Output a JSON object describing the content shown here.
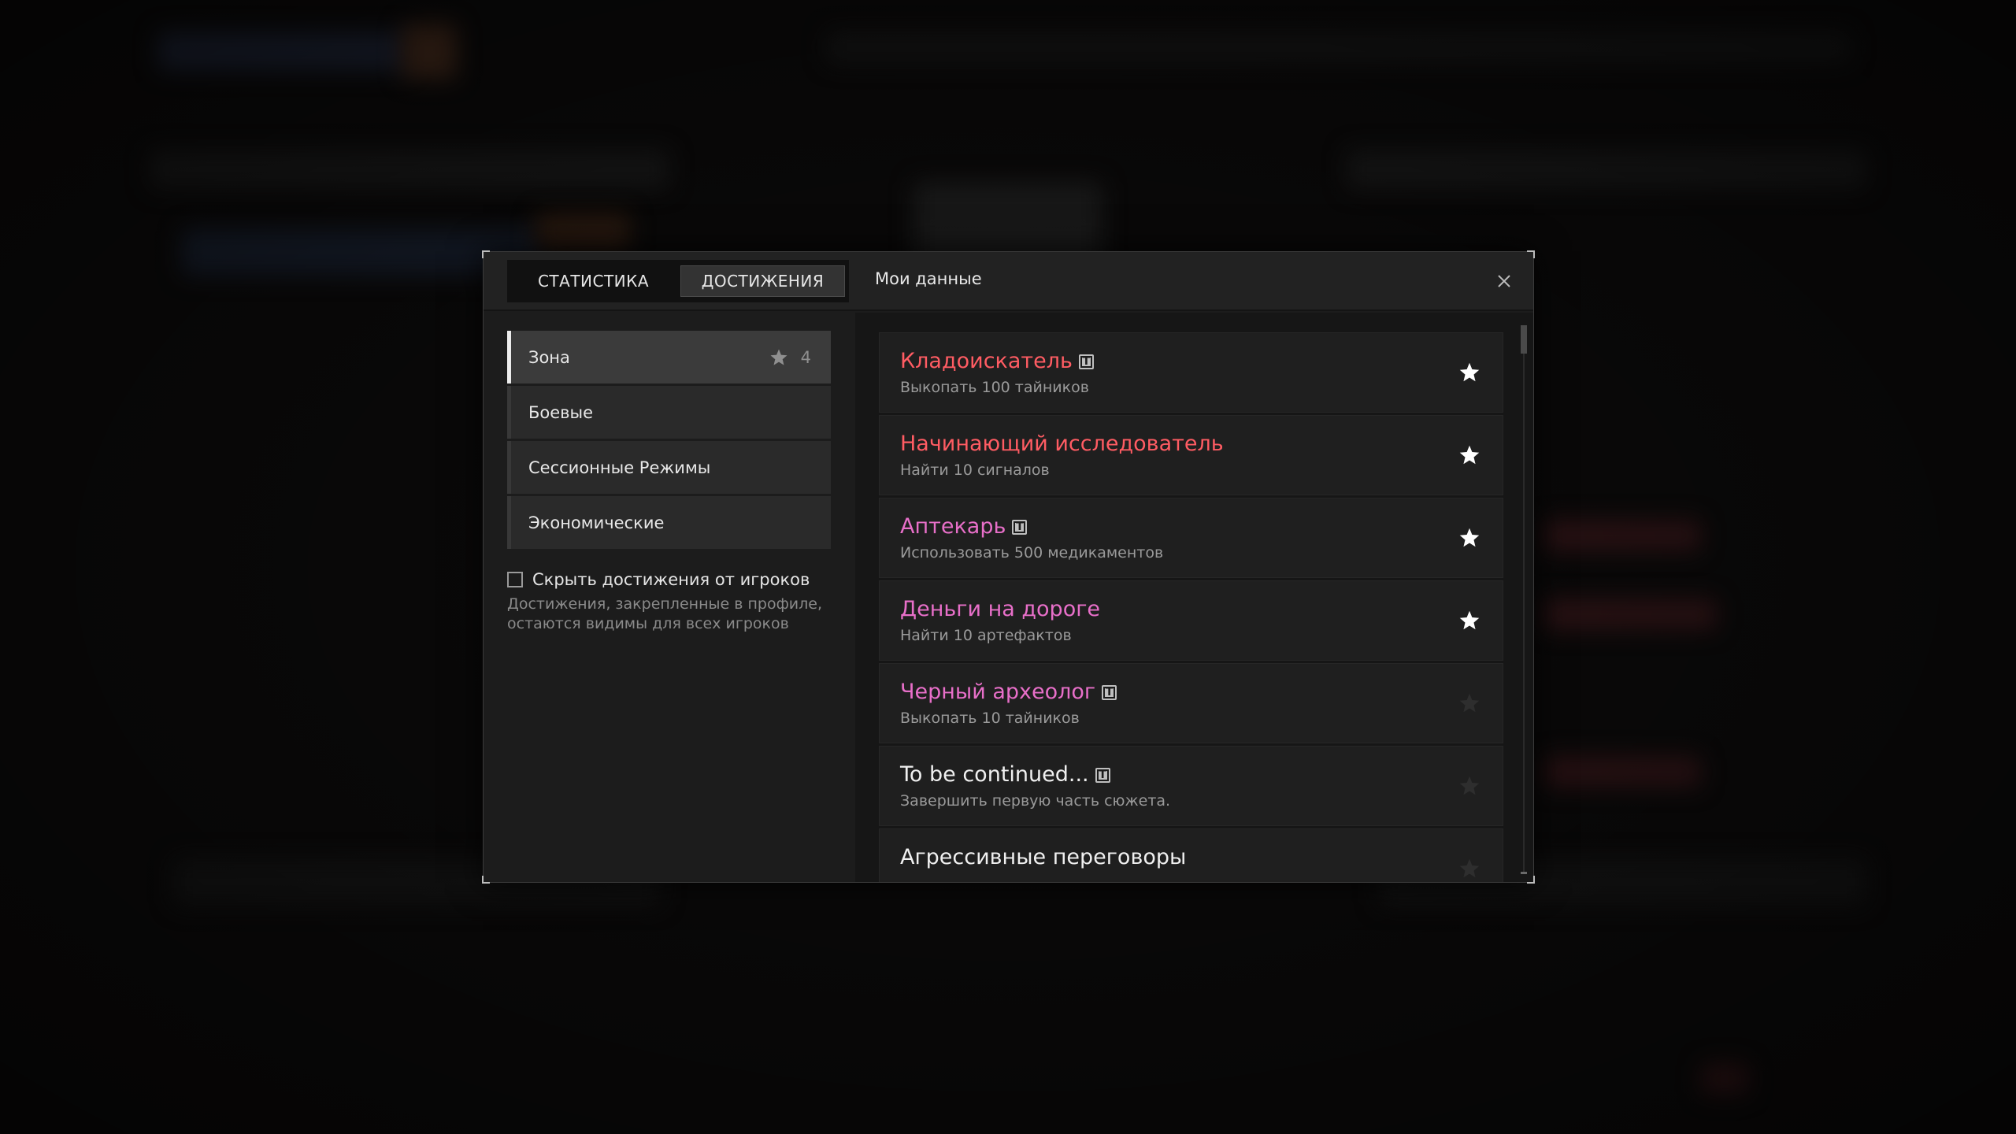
{
  "header": {
    "tabs": [
      {
        "label": "СТАТИСТИКА"
      },
      {
        "label": "ДОСТИЖЕНИЯ"
      }
    ],
    "title": "Мои данные"
  },
  "categories": [
    {
      "label": "Зона",
      "count": "4"
    },
    {
      "label": "Боевые"
    },
    {
      "label": "Сессионные Режимы"
    },
    {
      "label": "Экономические"
    }
  ],
  "hide_option": {
    "label": "Скрыть достижения от игроков",
    "note": "Достижения, закрепленные в профиле, остаются видимы для всех игроков"
  },
  "achievements": [
    {
      "title": "Кладоискатель",
      "desc": "Выкопать 100 тайников",
      "color": "#ff5c63",
      "starred": true
    },
    {
      "title": "Начинающий исследователь",
      "desc": "Найти 10 сигналов",
      "color": "#ff5c63",
      "starred": true
    },
    {
      "title": "Аптекарь",
      "desc": "Использовать 500 медикаментов",
      "color": "#e86fc9",
      "starred": true
    },
    {
      "title": "Деньги на дороге",
      "desc": "Найти 10 артефактов",
      "color": "#e86fc9",
      "starred": true
    },
    {
      "title": "Черный археолог",
      "desc": "Выкопать 10 тайников",
      "color": "#e86fc9",
      "starred": false
    },
    {
      "title": "To be continued...",
      "desc": "Завершить первую часть сюжета.",
      "color": "#f0f0f0",
      "starred": false
    },
    {
      "title": "Агрессивные переговоры",
      "desc": "",
      "color": "#f0f0f0",
      "starred": false
    }
  ],
  "badge_letter": "T",
  "colors": {
    "accent_red": "#ff5c63",
    "accent_pink": "#e86fc9",
    "star_active": "#ffffff",
    "star_inactive": "#2e2e2e"
  }
}
